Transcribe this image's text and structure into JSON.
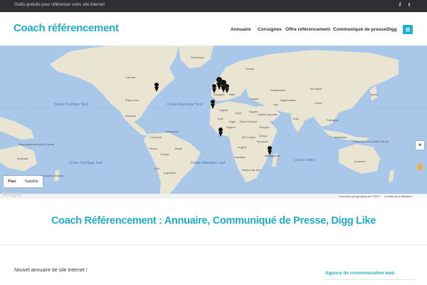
{
  "topbar": {
    "tagline": "Outils gratuits pour référencer votre site internet",
    "social_icons": [
      "facebook-icon",
      "twitter-icon"
    ],
    "social_glyphs": [
      "f",
      "t"
    ]
  },
  "header": {
    "logo": "Coach référencement",
    "nav": [
      "Annuaire",
      "Consignes",
      "Offre référencement",
      "Communiqué de presse",
      "Digg"
    ]
  },
  "map": {
    "buttons": [
      "Plan",
      "Satellite"
    ],
    "attribution": "Données cartographiques ©2017",
    "terms": "Conditions d'utilisation",
    "google": "Google",
    "labels": {
      "greenland": "Groenland",
      "canada": "Canada",
      "usa": "États-Unis",
      "mexico": "Mexique",
      "venezuela": "Venezuela",
      "colombia": "Colombie",
      "peru": "Pérou",
      "brazil": "Brésil",
      "bolivia": "Bolivie",
      "argentina": "Argentine",
      "chile": "Chili",
      "north_pacific": "Océan Pacifique Nord",
      "north_atlantic": "Océan Atlantique Nord",
      "south_pacific": "Océan Pacifique Sud",
      "south_atlantic": "Océan Atlantique Sud",
      "indian": "Océan Indien",
      "russia": "Russie",
      "kazakhstan": "Kazakhstan",
      "mongolia": "Mongolie",
      "china": "Chine",
      "india": "Inde",
      "iran": "Iran",
      "saudi": "Arabie saoudite",
      "algeria": "Algérie",
      "libya": "Libye",
      "egypt": "Égypte",
      "mali": "Mali",
      "niger": "Niger",
      "chad": "Tchad",
      "sudan": "Soudan",
      "nigeria": "Nigeria",
      "ethiopia": "Éthiopie",
      "drc": "RD Congo",
      "kenya": "Kenya",
      "tanzania": "Tanzanie",
      "angola": "Angola",
      "namibia": "Namibie",
      "madagascar": "Madagascar",
      "south_africa": "Afrique du Sud",
      "indonesia": "Indonésie",
      "png_left": "Papouasie-Nouvelle-Guinée",
      "png_right": "Papouasie-Nouvelle-Guinée",
      "australia_left": "Australie",
      "australia_right": "Australie",
      "nz": "Nouvelle-Zélande",
      "japan": "Japon",
      "thailand": "Thaïlande",
      "turkey": "Turquie",
      "afghanistan": "Afghanistan",
      "italy": "Italie",
      "spain": "Espagne",
      "france": "France"
    }
  },
  "page": {
    "title": "Coach Référencement : Annuaire, Communiqué de Presse, Digg Like",
    "post_title": "Nouvel annuaire de site internet !",
    "sidebar_title": "Agence de communication web"
  }
}
